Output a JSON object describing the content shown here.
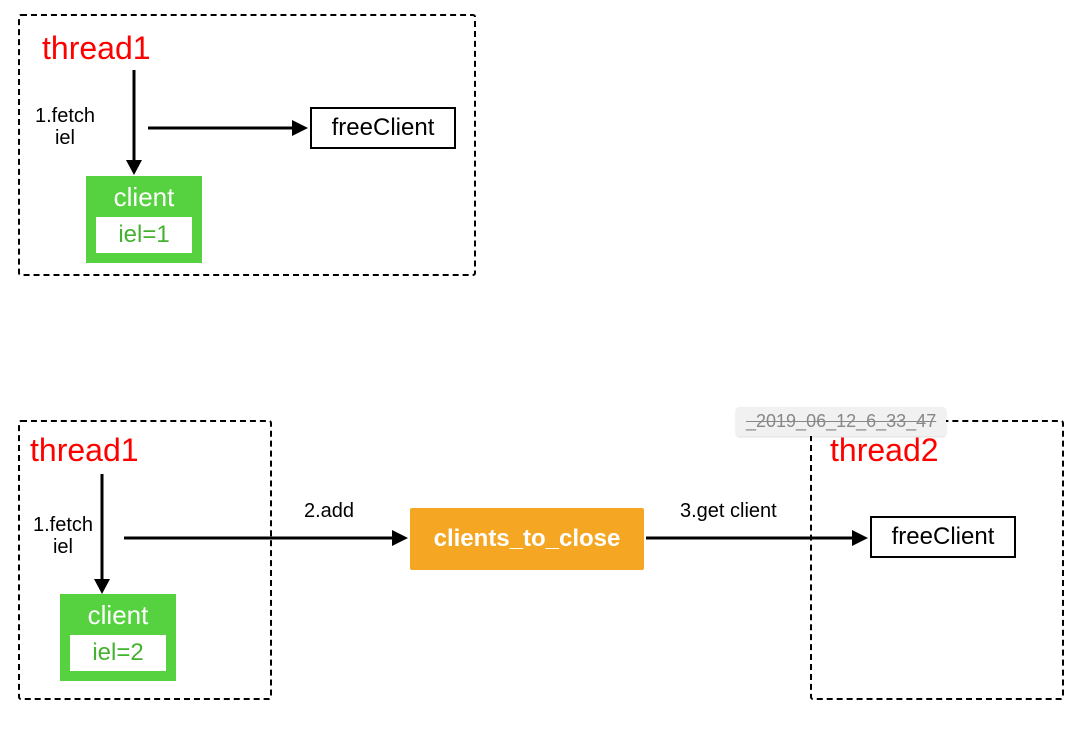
{
  "top": {
    "title": "thread1",
    "fetch_label": "1.fetch\niel",
    "client": {
      "title": "client",
      "iel": "iel=1"
    },
    "freeClient": "freeClient"
  },
  "bottom": {
    "leftTitle": "thread1",
    "rightTitle": "thread2",
    "fetch_label": "1.fetch\niel",
    "add_label": "2.add",
    "get_label": "3.get client",
    "client": {
      "title": "client",
      "iel": "iel=2"
    },
    "clients_to_close": "clients_to_close",
    "freeClient": "freeClient",
    "tooltip": "_2019_06_12_6_33_47"
  }
}
